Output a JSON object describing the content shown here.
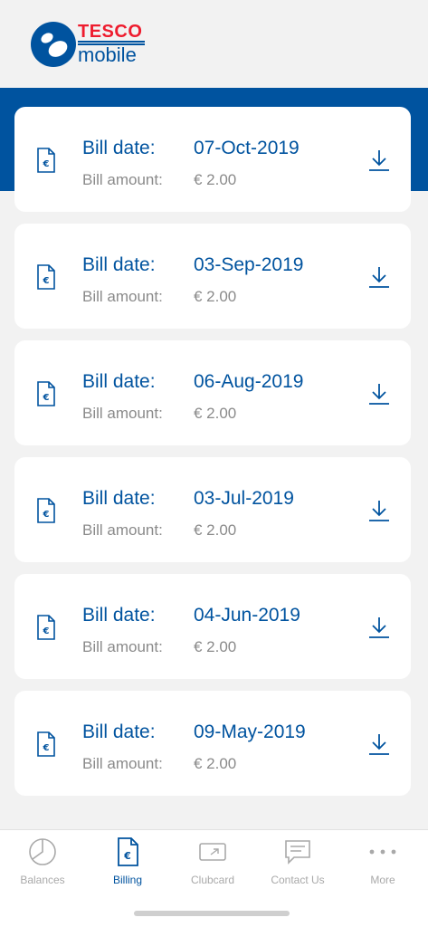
{
  "brand": {
    "tesco": "TESCO",
    "mobile": "mobile",
    "colors": {
      "primary": "#00539f",
      "red": "#ee1c2e"
    }
  },
  "bills": [
    {
      "date_label": "Bill date:",
      "date": "07-Oct-2019",
      "amount_label": "Bill amount:",
      "amount": "€ 2.00"
    },
    {
      "date_label": "Bill date:",
      "date": "03-Sep-2019",
      "amount_label": "Bill amount:",
      "amount": "€ 2.00"
    },
    {
      "date_label": "Bill date:",
      "date": "06-Aug-2019",
      "amount_label": "Bill amount:",
      "amount": "€ 2.00"
    },
    {
      "date_label": "Bill date:",
      "date": "03-Jul-2019",
      "amount_label": "Bill amount:",
      "amount": "€ 2.00"
    },
    {
      "date_label": "Bill date:",
      "date": "04-Jun-2019",
      "amount_label": "Bill amount:",
      "amount": "€ 2.00"
    },
    {
      "date_label": "Bill date:",
      "date": "09-May-2019",
      "amount_label": "Bill amount:",
      "amount": "€ 2.00"
    }
  ],
  "tabs": [
    {
      "label": "Balances",
      "icon": "pie-chart-icon",
      "active": false
    },
    {
      "label": "Billing",
      "icon": "bill-document-icon",
      "active": true
    },
    {
      "label": "Clubcard",
      "icon": "clubcard-icon",
      "active": false
    },
    {
      "label": "Contact Us",
      "icon": "chat-icon",
      "active": false
    },
    {
      "label": "More",
      "icon": "more-dots-icon",
      "active": false
    }
  ]
}
